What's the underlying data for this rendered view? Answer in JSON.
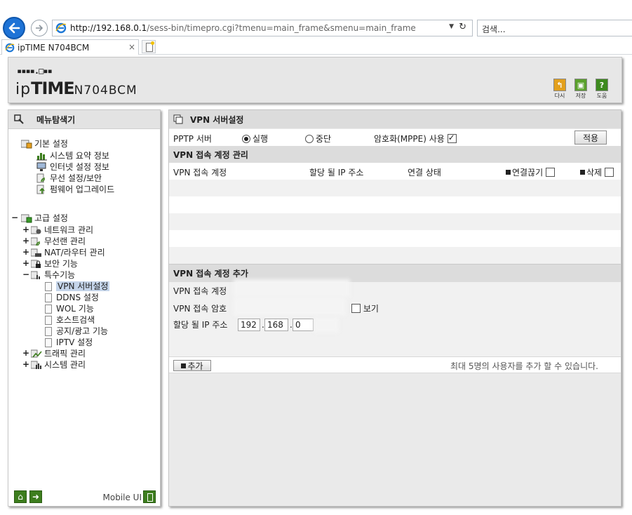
{
  "browser": {
    "url_host": "http://192.168.0.1",
    "url_path": "/sess-bin/timepro.cgi?tmenu=main_frame&smenu=main_frame",
    "search_placeholder": "검색...",
    "tab_title": "ipTIME N704BCM",
    "tab_close": "×"
  },
  "header": {
    "logo_mark": "▪▪▪▪.□▪▪",
    "logo_prefix": "ip",
    "logo_bold": "TIME",
    "logo_model": "N704BCM",
    "buttons": [
      {
        "label": "다시",
        "icon": "refresh-icon",
        "color": "#e3a01c"
      },
      {
        "label": "저장",
        "icon": "save-icon",
        "color": "#5aa02c"
      },
      {
        "label": "도움",
        "icon": "help-icon",
        "color": "#3d8a1e"
      }
    ]
  },
  "sidebar": {
    "title": "메뉴탐색기",
    "basic": {
      "label": "기본 설정",
      "items": [
        "시스템 요약 정보",
        "인터넷 설정 정보",
        "무선 설정/보안",
        "펌웨어 업그레이드"
      ]
    },
    "advanced": {
      "label": "고급 설정",
      "items": [
        "네트워크 관리",
        "무선랜 관리",
        "NAT/라우터 관리",
        "보안 기능",
        "특수기능"
      ],
      "special_items": [
        "VPN 서버설정",
        "DDNS 설정",
        "WOL 기능",
        "호스트검색",
        "공지/광고 기능",
        "IPTV 설정"
      ],
      "bottom_items": [
        "트래픽 관리",
        "시스템 관리"
      ]
    },
    "mobile_ui": "Mobile UI"
  },
  "main": {
    "title": "VPN 서버설정",
    "pptp_label": "PPTP 서버",
    "radio_run": "실행",
    "radio_stop": "중단",
    "mppe_label": "암호화(MPPE) 사용",
    "mppe_checked": true,
    "apply": "적용",
    "accounts_title": "VPN 접속 계정 관리",
    "columns": [
      "VPN 접속 계정",
      "할당 될 IP 주소",
      "연결 상태",
      "연결끊기",
      "삭제"
    ],
    "add_title": "VPN 접속 계정 추가",
    "account_label": "VPN 접속 계정",
    "password_label": "VPN 접속 암호",
    "show_label": "보기",
    "ip_label": "할당 될 IP 주소",
    "ip_parts": [
      "192",
      "168",
      "0"
    ],
    "add_button": "추가",
    "max_note": "최대 5명의 사용자를 추가 할 수 있습니다."
  }
}
